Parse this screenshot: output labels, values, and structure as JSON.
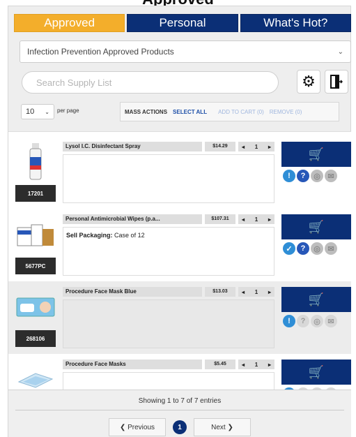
{
  "header": {
    "title": "Approved"
  },
  "tabs": [
    {
      "label": "Approved",
      "active": true
    },
    {
      "label": "Personal",
      "active": false
    },
    {
      "label": "What's Hot?",
      "active": false
    }
  ],
  "list_select": {
    "value": "Infection Prevention Approved Products"
  },
  "search": {
    "placeholder": "Search Supply List"
  },
  "toolbar": {
    "settings_icon": "gear-icon",
    "exit_icon": "door-exit-icon"
  },
  "per_page": {
    "value": "10",
    "label": "per page"
  },
  "mass_actions": {
    "label": "MASS ACTIONS",
    "select_all": "SELECT ALL",
    "add_to_cart": "ADD TO CART (0)",
    "remove": "REMOVE (0)"
  },
  "products": [
    {
      "name": "Lysol I.C. Disinfectant Spray",
      "price": "$14.29",
      "qty": "1",
      "sku": "17201",
      "description": "",
      "status": [
        "info",
        "question",
        "gray",
        "gray"
      ]
    },
    {
      "name": "Personal Antimicrobial Wipes (p.a...",
      "price": "$107.31",
      "qty": "1",
      "sku": "5677PC",
      "description_label": "Sell Packaging:",
      "description_value": "Case of 12",
      "status": [
        "check",
        "question",
        "gray",
        "gray"
      ]
    },
    {
      "name": "Procedure Face Mask Blue",
      "price": "$13.03",
      "qty": "1",
      "sku": "268106",
      "description": "",
      "status": [
        "info",
        "ghost",
        "ghost",
        "ghost"
      ]
    },
    {
      "name": "Procedure Face Masks",
      "price": "$5.45",
      "qty": "1",
      "sku": "",
      "description": "",
      "status": [
        "info",
        "ghost",
        "ghost",
        "ghost"
      ]
    }
  ],
  "footer": {
    "showing": "Showing 1 to 7 of 7 entries",
    "prev": "❮ Previous",
    "page": "1",
    "next": "Next ❯"
  },
  "colors": {
    "navy": "#0b2f76",
    "gold": "#f3ae2b",
    "accent_blue": "#2757b8"
  }
}
